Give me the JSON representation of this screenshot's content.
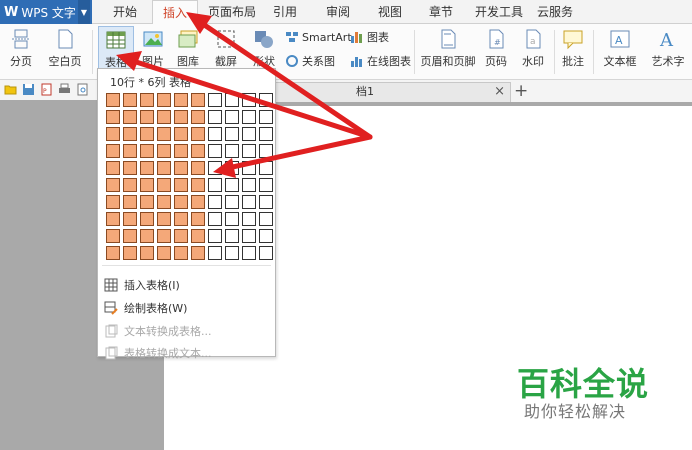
{
  "app": {
    "logo": "W",
    "name": "WPS 文字"
  },
  "tabs": [
    "开始",
    "插入",
    "页面布局",
    "引用",
    "审阅",
    "视图",
    "章节",
    "开发工具",
    "云服务"
  ],
  "active_tab": "插入",
  "ribbon": {
    "page_break": "分页",
    "blank_page": "空白页",
    "table": "表格",
    "picture": "图片",
    "gallery": "图库",
    "screenshot": "截屏",
    "shapes": "形状",
    "smartart": "SmartArt",
    "relation": "关系图",
    "chart": "图表",
    "online_chart": "在线图表",
    "header_footer": "页眉和页脚",
    "page_number": "页码",
    "watermark": "水印",
    "comment": "批注",
    "text_box": "文本框",
    "word_art": "艺术字"
  },
  "document": {
    "tab_title": "档1",
    "close_glyph": "×",
    "new_tab_glyph": "+"
  },
  "table_dropdown": {
    "grid_label": "10行 * 6列 表格",
    "rows": 10,
    "cols": 10,
    "selected_rows": 10,
    "selected_cols": 6,
    "insert_table": "插入表格(I)",
    "draw_table": "绘制表格(W)",
    "text_to_table": "文本转换成表格...",
    "table_to_text": "表格转换成文本..."
  },
  "watermark_brand": {
    "title": "百科全说",
    "subtitle": "助你轻松解决"
  },
  "colors": {
    "accent_red": "#e02020",
    "wps_blue": "#2f6db5",
    "cell_fill": "#f4a879",
    "brand_green": "#2aa445"
  }
}
